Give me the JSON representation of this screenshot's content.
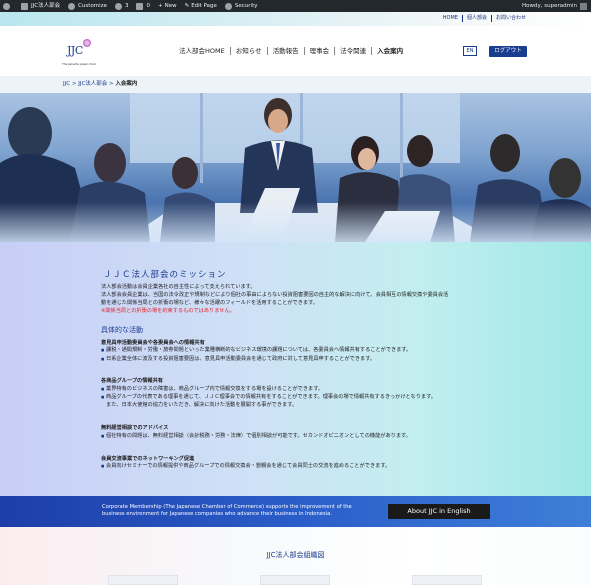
{
  "admin_bar": {
    "site_name": "JJC法人部会",
    "customize": "Customize",
    "updates_count": "3",
    "comments_count": "0",
    "new_label": "New",
    "edit_page": "Edit Page",
    "security": "Security",
    "howdy": "Howdy, superadmin"
  },
  "top_links": [
    "HOME",
    "個人部会",
    "お問い合わせ"
  ],
  "logo": {
    "text": "JJC",
    "subtitle": "The Jakarta Japan Club"
  },
  "global_nav": [
    "法人部会HOME",
    "お知らせ",
    "活動報告",
    "理事会",
    "法令関連",
    "入会案内"
  ],
  "header_buttons": {
    "en": "EN",
    "logout": "ログアウト"
  },
  "breadcrumb": {
    "items": [
      "JJC",
      "JJC法人部会"
    ],
    "current": "入会案内",
    "separator": " > "
  },
  "mission": {
    "title": "ＪＪＣ法人部会のミッション",
    "paragraphs": [
      "法人部会活動は会員企業各社の自主性によって支えられています。",
      "法人部会会員企業は、当国の法令改正や規制などにより個社の事由によらない投資阻害要因の自主的な解決に向けて、会員相互の情報交換や委員会活",
      "動を通じた関係当局との折衝の場など、様々な活躍のフィールドを活用することができます。"
    ],
    "note": "※関係当局との折衝の場を約束するものではありません。"
  },
  "activities": {
    "title": "具体的な活動",
    "groups": [
      {
        "heading": "意見具申活動委員会や各委員会への情報共有",
        "bullets": [
          "課税・通関規制・労働・旅券問題といった業種横断的なビジネス環境の課題については、各委員会へ情報共有することができます。",
          "日系企業全体に波及する投資阻害要因は、意見具申活動委員会を通じて政府に対して意見具申することができます。"
        ]
      },
      {
        "heading": "各商品グループの情報共有",
        "bullets": [
          "業界特有のビジネスの障害は、商品グループ内で情報交換をする場を設けることができます。",
          "商品グループの代表である理事を通じて、ＪＪＣ理事会での情報共有をすることができます。理事会の場で情報共有するきっかけとなります。",
          "また、日本大使館の協力をいただき、解決に向けた活動を展開する事ができます。"
        ]
      },
      {
        "heading": "無料経営相談でのアドバイス",
        "bullets": [
          "個社特有の問題は、無料経営相談（会計税務・労務・法律）で個別相談が可能です。セカンドオピニオンとしての機能があります。"
        ]
      },
      {
        "heading": "会員交流事業でのネットワーキング促進",
        "bullets": [
          "会員向けセミナーでの情報提供や商品グループでの情報交換会・懇親会を通じて会員同士の交流を進めることができます。"
        ]
      }
    ]
  },
  "band": {
    "text_line1": "Corporate Membership (The Japanese Chamber of Commerce) supports the improvement of the",
    "text_line2": "business environment for Japanese companies who advance their business in Indonesia.",
    "button": "About JJC in English"
  },
  "org": {
    "title": "JJC法人部会組織図"
  },
  "colors": {
    "accent": "#1b3d8f",
    "note_red": "#e3242b",
    "admin_bar": "#23282d"
  }
}
